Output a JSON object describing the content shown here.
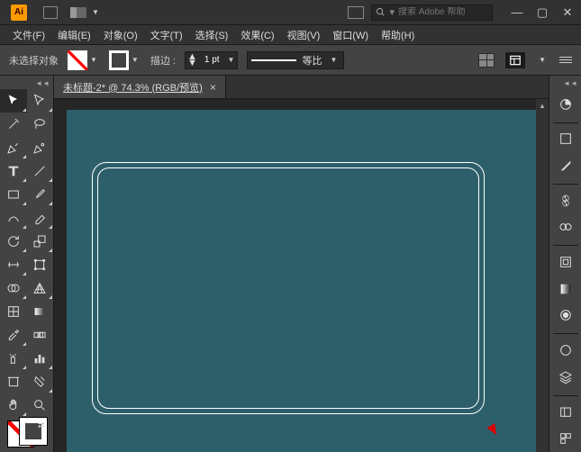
{
  "app": {
    "name": "Ai"
  },
  "search": {
    "placeholder": "搜索 Adobe 帮助"
  },
  "menus": [
    {
      "label": "文件(F)"
    },
    {
      "label": "编辑(E)"
    },
    {
      "label": "对象(O)"
    },
    {
      "label": "文字(T)"
    },
    {
      "label": "选择(S)"
    },
    {
      "label": "效果(C)"
    },
    {
      "label": "视图(V)"
    },
    {
      "label": "窗口(W)"
    },
    {
      "label": "帮助(H)"
    }
  ],
  "options": {
    "selection": "未选择对象",
    "stroke_label": "描边 :",
    "stroke_weight": "1 pt",
    "profile_label": "等比"
  },
  "document": {
    "tab_title": "未标题-2* @ 74.3% (RGB/预览)"
  },
  "colors": {
    "canvas_bg": "#2d5f6b",
    "panel_bg": "#434343"
  }
}
